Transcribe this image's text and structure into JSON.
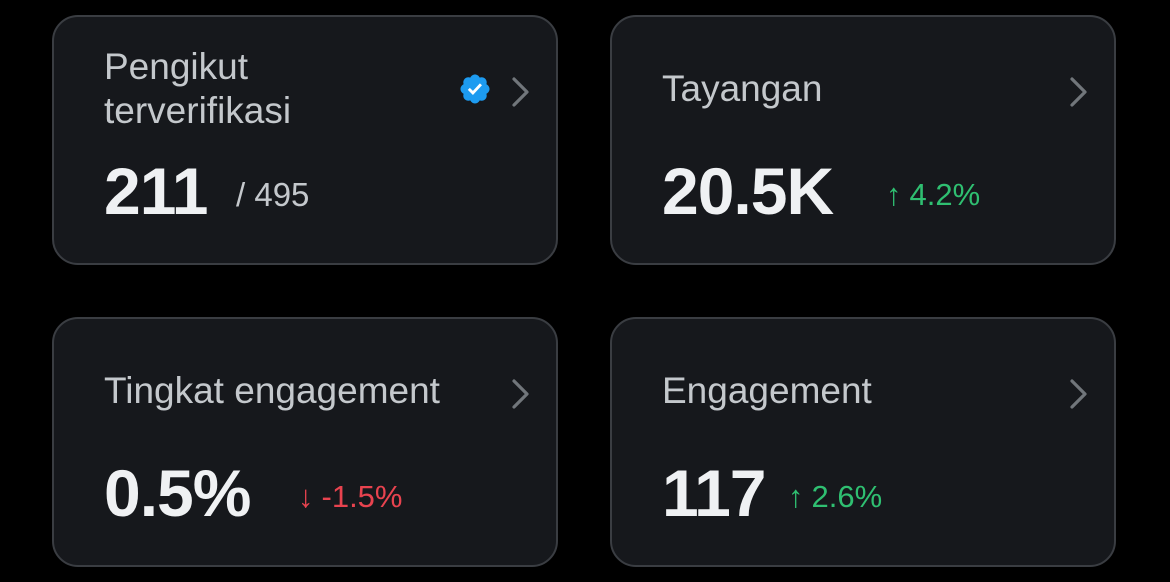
{
  "cards": [
    {
      "label": "Pengikut terverifikasi",
      "value": "211",
      "total": "/ 495",
      "verified_icon": "verified-badge-icon",
      "badge_color": "#1d9bf0"
    },
    {
      "label": "Tayangan",
      "value": "20.5K",
      "delta_arrow": "↑",
      "delta": "4.2%",
      "delta_direction": "up"
    },
    {
      "label": "Tingkat engagement",
      "value": "0.5%",
      "delta_arrow": "↓",
      "delta": "-1.5%",
      "delta_direction": "down"
    },
    {
      "label": "Engagement",
      "value": "117",
      "delta_arrow": "↑",
      "delta": "2.6%",
      "delta_direction": "up"
    }
  ],
  "icons": {
    "chevron": "chevron-right-icon"
  },
  "colors": {
    "background": "#000000",
    "card_background": "#16181c",
    "card_border": "#3a3d42",
    "positive": "#2fbf71",
    "negative": "#e8434f",
    "verified": "#1d9bf0"
  }
}
